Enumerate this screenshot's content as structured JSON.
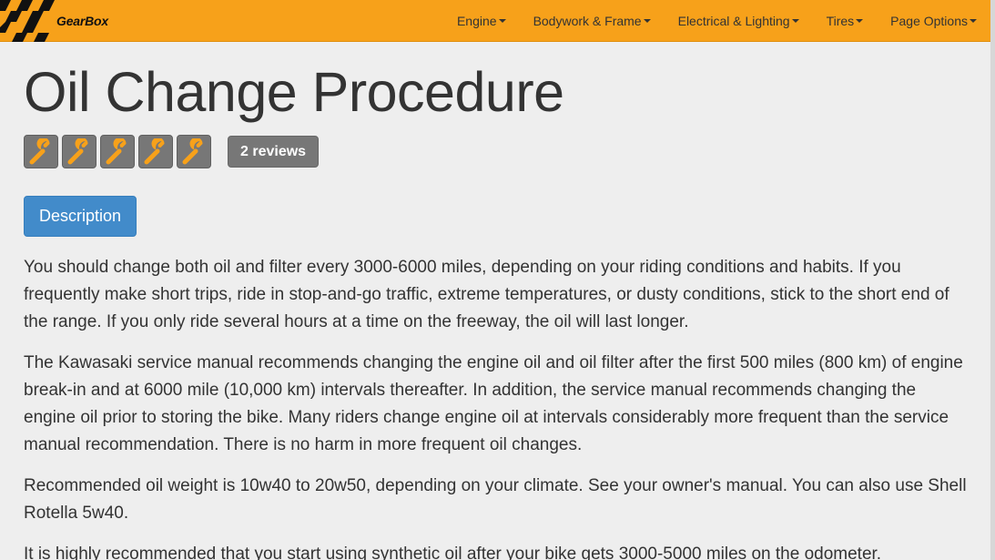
{
  "nav": {
    "brand": "GearBox",
    "items": [
      {
        "label": "Engine"
      },
      {
        "label": "Bodywork & Frame"
      },
      {
        "label": "Electrical & Lighting"
      },
      {
        "label": "Tires"
      },
      {
        "label": "Page Options"
      }
    ]
  },
  "page": {
    "title": "Oil Change Procedure",
    "rating_icon": "wrench-icon",
    "rating": 5,
    "rating_max": 5,
    "reviews_label": "2 reviews",
    "tab_label": "Description"
  },
  "paragraphs": [
    "You should change both oil and filter every 3000-6000 miles, depending on your riding conditions and habits. If you frequently make short trips, ride in stop-and-go traffic, extreme temperatures, or dusty conditions, stick to the short end of the range. If you only ride several hours at a time on the freeway, the oil will last longer.",
    "The Kawasaki service manual recommends changing the engine oil and oil filter after the first 500 miles (800 km) of engine break-in and at 6000 mile (10,000 km) intervals thereafter. In addition, the service manual recommends changing the engine oil prior to storing the bike. Many riders change engine oil at intervals considerably more frequent than the service manual recommendation. There is no harm in more frequent oil changes.",
    "Recommended oil weight is 10w40 to 20w50, depending on your climate. See your owner's manual. You can also use Shell Rotella 5w40.",
    "It is highly recommended that you start using synthetic oil after your bike gets 3000-5000 miles on the odometer."
  ],
  "colors": {
    "navbar": "#f7a11a",
    "wrench": "#f7a11a",
    "badge": "#777777",
    "primary": "#428bca"
  }
}
